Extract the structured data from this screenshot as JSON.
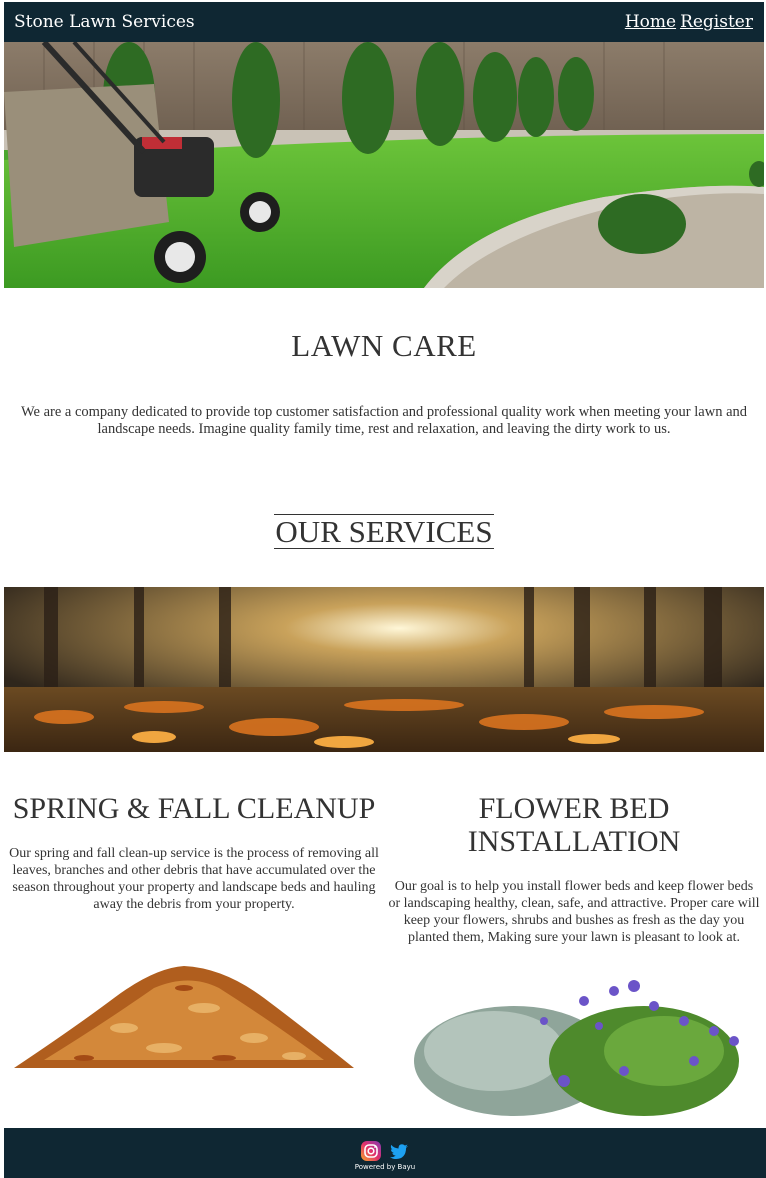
{
  "header": {
    "brand": "Stone Lawn Services",
    "nav": {
      "home": "Home",
      "register": "Register"
    }
  },
  "main": {
    "lawn_title": "LAWN CARE",
    "intro": "We are a company dedicated to provide top customer satisfaction and professional quality work when meeting your lawn and landscape needs. Imagine quality family time, rest and relaxation, and leaving the dirty work to us.",
    "services_title": "OUR SERVICES",
    "services": [
      {
        "title": "SPRING & FALL CLEANUP",
        "text": "Our spring and fall clean-up service is the process of removing all leaves, branches and other debris that have accumulated over the season throughout your property and landscape beds and hauling away the debris from your property."
      },
      {
        "title": "FLOWER BED INSTALLATION",
        "text": "Our goal is to help you install flower beds and keep flower beds or landscaping healthy, clean, safe, and attractive. Proper care will keep your flowers, shrubs and bushes as fresh as the day you planted them, Making sure your lawn is pleasant to look at."
      }
    ]
  },
  "footer": {
    "powered": "Powered by Bayu",
    "icons": [
      "instagram-icon",
      "twitter-icon"
    ]
  },
  "colors": {
    "header_bg": "#0f2733",
    "text": "#333333"
  }
}
